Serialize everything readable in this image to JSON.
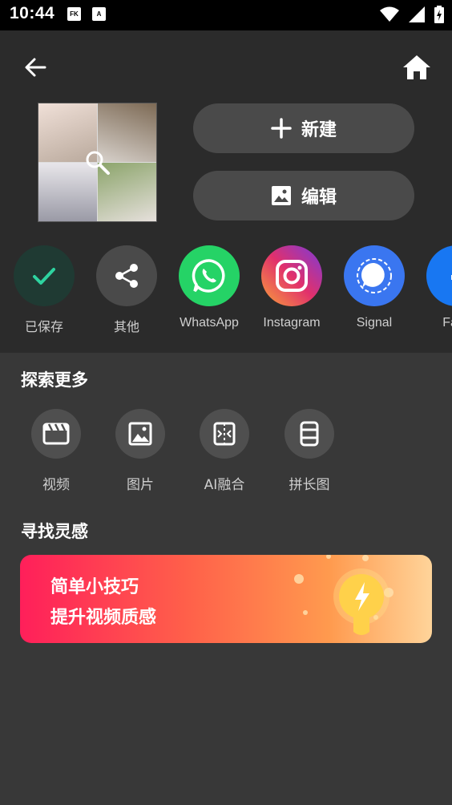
{
  "status_bar": {
    "time": "10:44",
    "icon_left_1": "FK",
    "icon_left_2": "A"
  },
  "actions": {
    "new_label": "新建",
    "edit_label": "编辑"
  },
  "share_targets": [
    {
      "label": "已保存",
      "icon": "check-icon",
      "color": "#1f3a33"
    },
    {
      "label": "其他",
      "icon": "share-icon",
      "color": "#4a4a4a"
    },
    {
      "label": "WhatsApp",
      "icon": "whatsapp-icon",
      "color": "#25d366"
    },
    {
      "label": "Instagram",
      "icon": "instagram-icon",
      "color": "#e1306c"
    },
    {
      "label": "Signal",
      "icon": "signal-icon",
      "color": "#3a76f0"
    },
    {
      "label": "Face",
      "icon": "facebook-icon",
      "color": "#1877f2"
    }
  ],
  "explore": {
    "title": "探索更多",
    "tools": [
      {
        "label": "视频",
        "icon": "video-icon"
      },
      {
        "label": "图片",
        "icon": "image-icon"
      },
      {
        "label": "AI融合",
        "icon": "ai-merge-icon"
      },
      {
        "label": "拼长图",
        "icon": "long-image-icon"
      }
    ]
  },
  "inspiration": {
    "title": "寻找灵感",
    "banner_line1": "简单小技巧",
    "banner_line2": "提升视频质感"
  }
}
